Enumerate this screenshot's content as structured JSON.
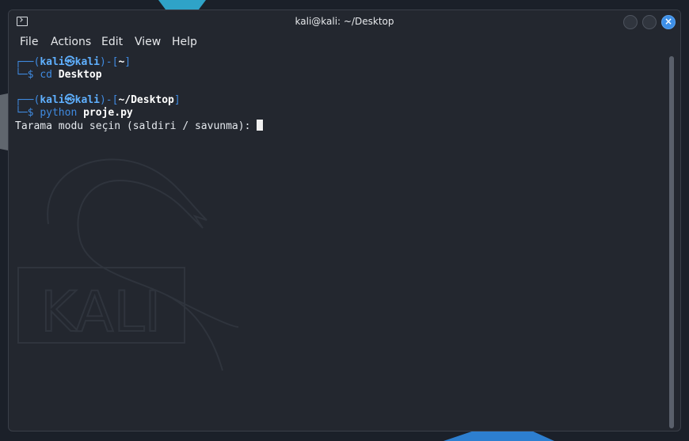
{
  "window": {
    "title": "kali@kali: ~/Desktop"
  },
  "menu": {
    "items": [
      "File",
      "Actions",
      "Edit",
      "View",
      "Help"
    ]
  },
  "terminal": {
    "prompt1": {
      "open": "┌──(",
      "user": "kali",
      "at": "㉿",
      "host": "kali",
      "mid": ")-[",
      "path": "~",
      "close": "]",
      "dollar": "└─$",
      "cmd": "cd",
      "arg": "Desktop"
    },
    "prompt2": {
      "open": "┌──(",
      "user": "kali",
      "at": "㉿",
      "host": "kali",
      "mid": ")-[",
      "path": "~/Desktop",
      "close": "]",
      "dollar": "└─$",
      "cmd": "python",
      "arg": "proje.py"
    },
    "output": "Tarama modu seçin (saldiri / savunma): "
  },
  "watermark": {
    "text": "KALI"
  },
  "colors": {
    "prompt_frame": "#3f8ae0",
    "prompt_user": "#5fb0ff",
    "close_button": "#3d8fe8",
    "background": "#23272f"
  }
}
